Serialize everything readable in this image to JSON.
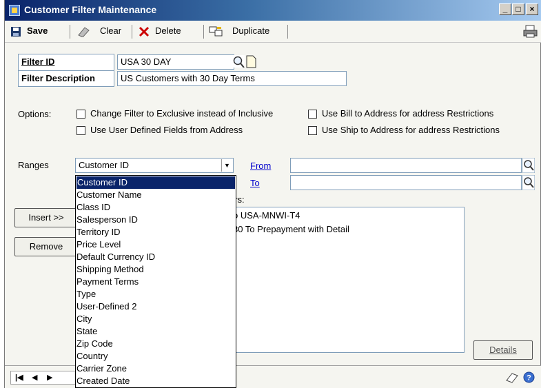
{
  "window": {
    "title": "Customer Filter Maintenance"
  },
  "toolbar": {
    "save": "Save",
    "clear": "Clear",
    "delete": "Delete",
    "duplicate": "Duplicate"
  },
  "filter": {
    "id_label": "Filter ID",
    "id_value": "USA 30 DAY",
    "description_label": "Filter Description",
    "description_value": "US Customers with 30 Day Terms"
  },
  "options": {
    "label": "Options:",
    "change_exclusive": "Change Filter to Exclusive instead of Inclusive",
    "use_bill_to": "Use Bill to Address for address Restrictions",
    "use_user_defined": "Use User Defined Fields from Address",
    "use_ship_to": "Use Ship to Address for address Restrictions"
  },
  "ranges": {
    "label": "Ranges",
    "selected": "Customer ID",
    "from_label": "From",
    "to_label": "To",
    "from_value": "",
    "to_value": ""
  },
  "dropdown_options": [
    "Customer ID",
    "Customer Name",
    "Class ID",
    "Salesperson ID",
    "Territory ID",
    "Price Level",
    "Default Currency ID",
    "Shipping Method",
    "Payment Terms",
    "Type",
    "User-Defined 2",
    "City",
    "State",
    "Zip Code",
    "Country",
    "Carrier Zone",
    "Created Date"
  ],
  "restrictions": {
    "header_partial": "ers:",
    "items": [
      "o USA-MNWI-T4",
      "30 To Prepayment with Detail"
    ]
  },
  "buttons": {
    "insert": "Insert >>",
    "remove": "Remove",
    "details": "Details"
  }
}
